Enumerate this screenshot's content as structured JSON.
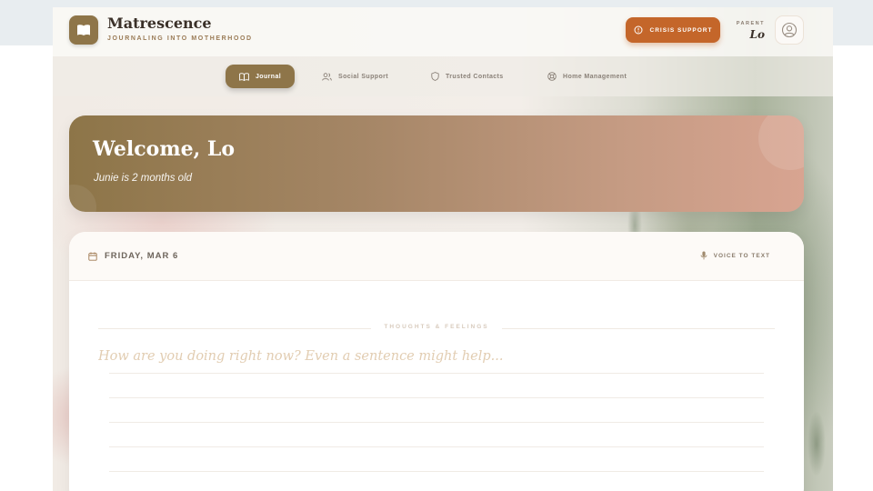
{
  "app": {
    "name": "Matrescence",
    "tagline": "JOURNALING INTO MOTHERHOOD"
  },
  "header": {
    "crisis_label": "CRISIS SUPPORT",
    "parent_role": "PARENT",
    "parent_name": "Lo"
  },
  "nav": {
    "items": [
      {
        "label": "Journal",
        "icon": "book-icon",
        "active": true
      },
      {
        "label": "Social Support",
        "icon": "users-icon",
        "active": false
      },
      {
        "label": "Trusted Contacts",
        "icon": "shield-icon",
        "active": false
      },
      {
        "label": "Home Management",
        "icon": "lifebuoy-icon",
        "active": false
      }
    ]
  },
  "welcome": {
    "title": "Welcome, Lo",
    "subtitle": "Junie is 2 months old"
  },
  "journal": {
    "date": "FRIDAY, MAR 6",
    "voice_label": "VOICE TO TEXT",
    "section_label": "THOUGHTS & FEELINGS",
    "placeholder": "How are you doing right now? Even a sentence might help...",
    "value": ""
  },
  "colors": {
    "brand": "#8e7549",
    "crisis": "#c4662a",
    "welcome_start": "#8d7548",
    "welcome_end": "#d8a491"
  }
}
